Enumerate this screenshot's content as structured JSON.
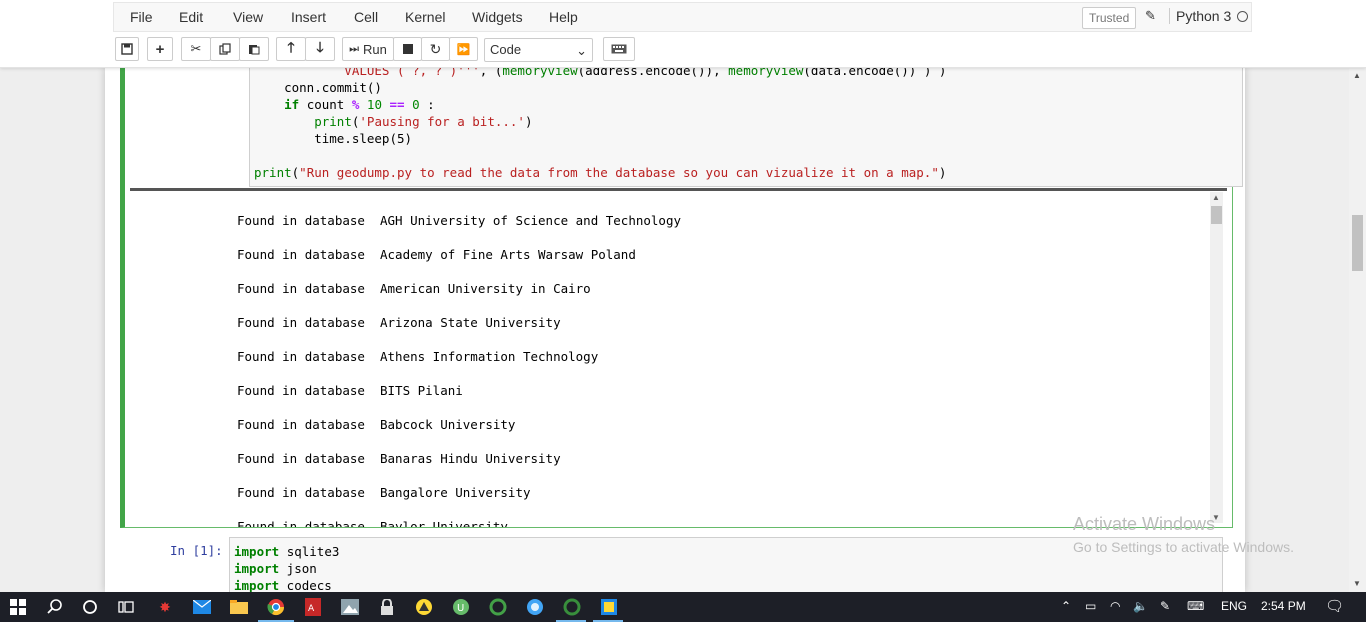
{
  "menubar": {
    "items": [
      "File",
      "Edit",
      "View",
      "Insert",
      "Cell",
      "Kernel",
      "Widgets",
      "Help"
    ],
    "trusted": "Trusted",
    "kernel_name": "Python 3"
  },
  "toolbar": {
    "run_label": "Run",
    "cell_type": "Code"
  },
  "cell1": {
    "code_lines": [
      "            VALUES ( ?, ? )''', (memoryview(address.encode()), memoryview(data.encode()) ) )",
      "    conn.commit()",
      "    if count % 10 == 0 :",
      "        print('Pausing for a bit...')",
      "        time.sleep(5)",
      "",
      "print(\"Run geodump.py to read the data from the database so you can vizualize it on a map.\")"
    ],
    "output_lines": [
      "Found in database  AGH University of Science and Technology",
      "Found in database  Academy of Fine Arts Warsaw Poland",
      "Found in database  American University in Cairo",
      "Found in database  Arizona State University",
      "Found in database  Athens Information Technology",
      "Found in database  BITS Pilani",
      "Found in database  Babcock University",
      "Found in database  Banaras Hindu University",
      "Found in database  Bangalore University",
      "Found in database  Baylor University"
    ]
  },
  "cell2": {
    "prompt": "In [1]:",
    "code_lines": [
      "import sqlite3",
      "import json",
      "import codecs"
    ]
  },
  "watermark": {
    "line1": "Activate Windows",
    "line2": "Go to Settings to activate Windows."
  },
  "taskbar": {
    "language": "ENG",
    "time": "2:54 PM"
  },
  "colors": {
    "selected_cell_border": "#42a548",
    "keyword": "#008000",
    "string": "#ba2121",
    "prompt": "#303f9f"
  }
}
